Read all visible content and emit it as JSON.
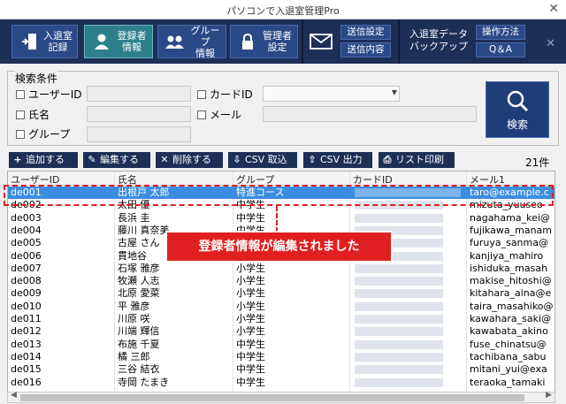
{
  "window": {
    "title": "パソコンで入退室管理Pro",
    "close_glyph": "✕"
  },
  "toolbar": {
    "checkin_label": "入退室\n記録",
    "register_label": "登録者\n情報",
    "group_label": "グループ\n情報",
    "admin_label": "管理者\n設定",
    "send_settings_label": "送信設定",
    "send_content_label": "送信内容",
    "backup_label": "入退室データ\nバックアップ",
    "howto_label": "操作方法",
    "qa_label": "Q＆A",
    "extra_close": "✕"
  },
  "search": {
    "legend": "検索条件",
    "user_id_label": "ユーザーID",
    "card_id_label": "カードID",
    "name_label": "氏名",
    "email_label": "メール",
    "group_label": "グループ",
    "button_label": "検索"
  },
  "actions": {
    "add_label": "追加する",
    "edit_label": "編集する",
    "delete_label": "削除する",
    "csv_import_label": "CSV 取込",
    "csv_export_label": "CSV 出力",
    "print_label": "リスト印刷",
    "count_text": "21件"
  },
  "table": {
    "headers": [
      "ユーザーID",
      "氏名",
      "グループ",
      "カードID",
      "メール1"
    ],
    "rows": [
      {
        "id": "de001",
        "name": "出根戸 太郎",
        "group": "特進コース",
        "email": "taro@example.c"
      },
      {
        "id": "de002",
        "name": "太田 優",
        "group": "中学生",
        "email": "mizuta_yuuseo"
      },
      {
        "id": "de003",
        "name": "長浜 圭",
        "group": "中学生",
        "email": "nagahama_kei@"
      },
      {
        "id": "de004",
        "name": "藤川 真奈美",
        "group": "中学生",
        "email": "fujikawa_manam"
      },
      {
        "id": "de005",
        "name": "古屋 さん",
        "group": "",
        "email": "furuya_sanma@"
      },
      {
        "id": "de006",
        "name": "貫地谷 ",
        "group": "",
        "email": "kanjiya_mahiro"
      },
      {
        "id": "de007",
        "name": "石塚 雅彦",
        "group": "小学生",
        "email": "ishiduka_masah"
      },
      {
        "id": "de008",
        "name": "牧瀬 人志",
        "group": "小学生",
        "email": "makise_hitoshi@"
      },
      {
        "id": "de009",
        "name": "北原 愛菜",
        "group": "小学生",
        "email": "kitahara_aina@e"
      },
      {
        "id": "de010",
        "name": "平 雅彦",
        "group": "小学生",
        "email": "taira_masahiko@"
      },
      {
        "id": "de011",
        "name": "川原 咲",
        "group": "小学生",
        "email": "kawahara_saki@"
      },
      {
        "id": "de012",
        "name": "川端 輝信",
        "group": "小学生",
        "email": "kawabata_akino"
      },
      {
        "id": "de013",
        "name": "布施 千夏",
        "group": "中学生",
        "email": "fuse_chinatsu@"
      },
      {
        "id": "de014",
        "name": "橘 三郎",
        "group": "中学生",
        "email": "tachibana_sabu"
      },
      {
        "id": "de015",
        "name": "三谷 結衣",
        "group": "中学生",
        "email": "mitani_yui@exa"
      },
      {
        "id": "de016",
        "name": "寺岡 たまき",
        "group": "中学生",
        "email": "teraoka_tamaki"
      }
    ]
  },
  "notice": {
    "text": "登録者情報が編集されました"
  },
  "colors": {
    "toolbar": "#1c2f57",
    "selected_row": "#3b8de0",
    "notice": "#e02020"
  }
}
